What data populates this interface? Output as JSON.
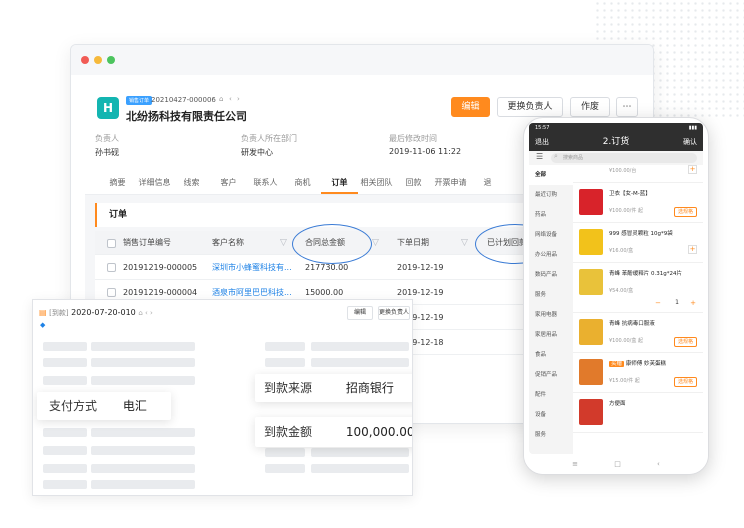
{
  "crm": {
    "tag": "销售订单",
    "record_no": "20210427-000006",
    "company": "北纷扬科技有限责任公司",
    "buttons": {
      "edit": "编辑",
      "change_owner": "更换负责人",
      "void": "作废",
      "more": "⋯"
    },
    "info": [
      {
        "label": "负责人",
        "value": "孙书砚"
      },
      {
        "label": "负责人所在部门",
        "value": "研发中心"
      },
      {
        "label": "最后修改时间",
        "value": "2019-11-06 11:22"
      }
    ],
    "tabs": [
      "摘要",
      "详细信息",
      "线索",
      "客户",
      "联系人",
      "商机",
      "订单",
      "相关团队",
      "回款",
      "开票申请",
      "退"
    ],
    "active_tab": "订单",
    "section_title": "订单",
    "columns": [
      "销售订单编号",
      "客户名称",
      "合同总金额",
      "下单日期",
      "已计划回款"
    ],
    "rows": [
      {
        "no": "20191219-000005",
        "customer": "深圳市小蜂蜜科技有...",
        "amount": "217730.00",
        "date": "2019-12-19"
      },
      {
        "no": "20191219-000004",
        "customer": "酒泉市阿里巴巴科技...",
        "amount": "15000.00",
        "date": "2019-12-19"
      },
      {
        "no": "",
        "customer": "",
        "amount": "",
        "date": "2019-12-19"
      },
      {
        "no": "",
        "customer": "",
        "amount": "",
        "date": "2019-12-18"
      }
    ]
  },
  "payment": {
    "tag": "[到款]",
    "date_no": "2020-07-20-010",
    "buttons": {
      "edit": "编辑",
      "change_owner": "更换负责人"
    },
    "fields": [
      {
        "label": "支付方式",
        "value": "电汇"
      },
      {
        "label": "到款来源",
        "value": "招商银行"
      },
      {
        "label": "到款金额",
        "value": "100,000.00"
      }
    ]
  },
  "phone": {
    "time": "15:57",
    "back": "退出",
    "title": "2.订货",
    "confirm": "确认",
    "search_placeholder": "搜索商品",
    "categories": [
      "全部",
      "最近订购",
      "药品",
      "网络设备",
      "办公用品",
      "数码产品",
      "服务",
      "家用电器",
      "家居用品",
      "食品",
      "促销产品",
      "配件",
      "设备",
      "服务"
    ],
    "items": [
      {
        "name": "",
        "price": "¥100.00/台"
      },
      {
        "name": "卫衣【女-M-蓝】",
        "price": "¥100.00/件 起",
        "action": "选规格"
      },
      {
        "name": "999 感冒灵颗粒 10g*9袋",
        "price": "¥16.00/盒"
      },
      {
        "name": "青峰 苯酚缓释片 0.31g*24片",
        "price": "¥54.00/盒",
        "qty": "1"
      },
      {
        "name": "青峰 抗病毒口服液",
        "price": "¥100.00/盒 起",
        "action": "选规格"
      },
      {
        "name": "康师傅 妙芙蛋糕",
        "badge": "买赠",
        "price": "¥15.00/件 起",
        "action": "选规格"
      },
      {
        "name": "方便面",
        "price": ""
      }
    ],
    "nav": [
      "≡",
      "□",
      "‹"
    ]
  },
  "colors": {
    "accent": "#ff8a1e",
    "link": "#1e82e6",
    "phone_dark": "#2f2f2f"
  }
}
